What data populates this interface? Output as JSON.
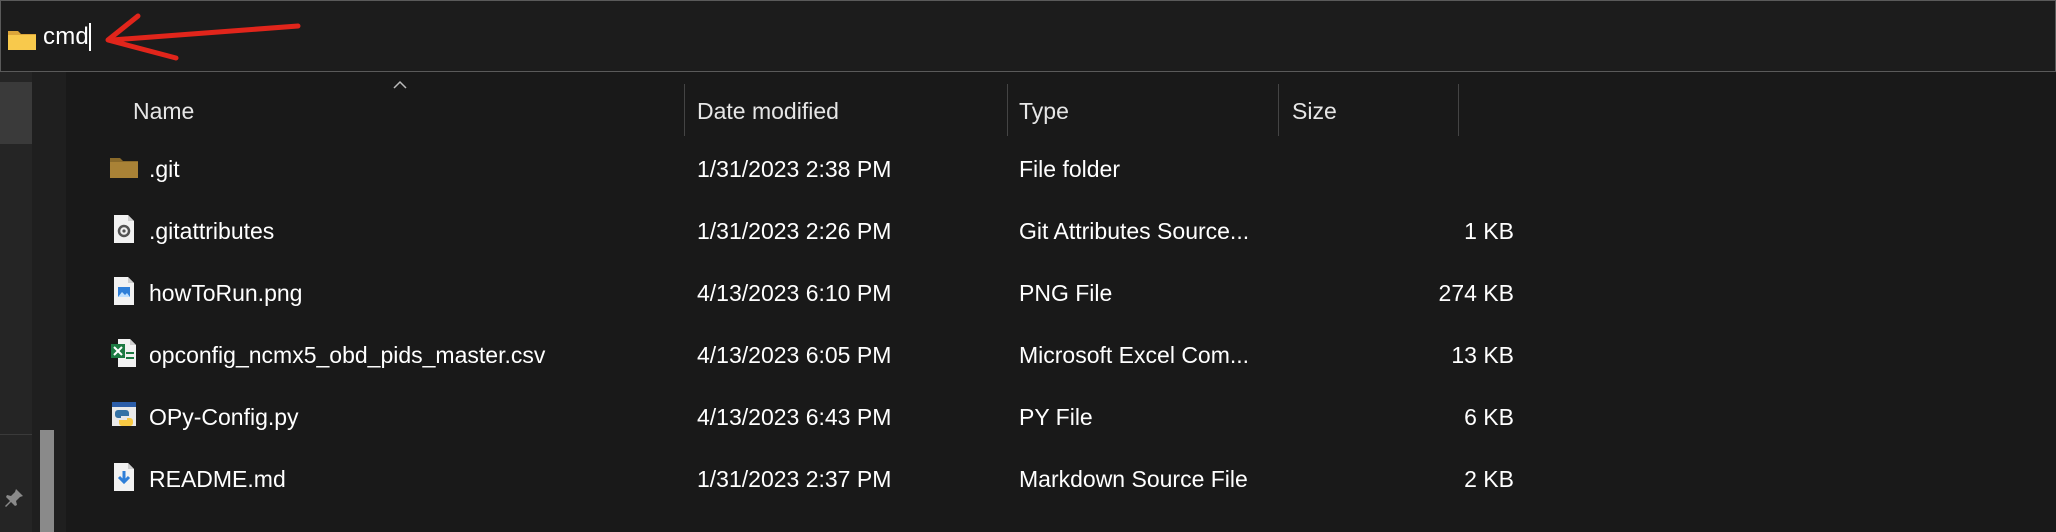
{
  "address_bar": {
    "value": "cmd"
  },
  "columns": {
    "name": "Name",
    "date": "Date modified",
    "type": "Type",
    "size": "Size"
  },
  "files": [
    {
      "name": ".git",
      "date": "1/31/2023 2:38 PM",
      "type": "File folder",
      "size": "",
      "icon": "folder-icon"
    },
    {
      "name": ".gitattributes",
      "date": "1/31/2023 2:26 PM",
      "type": "Git Attributes Source...",
      "size": "1 KB",
      "icon": "settings-file-icon"
    },
    {
      "name": "howToRun.png",
      "date": "4/13/2023 6:10 PM",
      "type": "PNG File",
      "size": "274 KB",
      "icon": "image-file-icon"
    },
    {
      "name": "opconfig_ncmx5_obd_pids_master.csv",
      "date": "4/13/2023 6:05 PM",
      "type": "Microsoft Excel Com...",
      "size": "13 KB",
      "icon": "excel-file-icon"
    },
    {
      "name": "OPy-Config.py",
      "date": "4/13/2023 6:43 PM",
      "type": "PY File",
      "size": "6 KB",
      "icon": "python-file-icon"
    },
    {
      "name": "README.md",
      "date": "1/31/2023 2:37 PM",
      "type": "Markdown Source File",
      "size": "2 KB",
      "icon": "markdown-file-icon"
    }
  ],
  "colors": {
    "background": "#191919",
    "annotation": "#e1251b",
    "folder": "#f8c94c"
  }
}
